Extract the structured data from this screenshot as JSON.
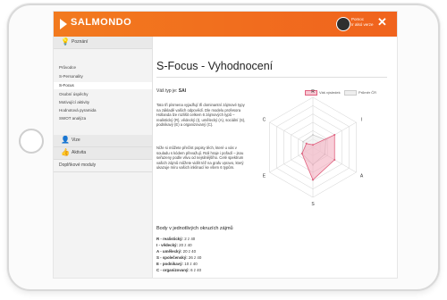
{
  "app": {
    "logo": "SALMONDO"
  },
  "user": {
    "line1": "Pomoc",
    "line2": "Ir alsó verze"
  },
  "sidebar": {
    "sections": [
      {
        "title": "Poznání",
        "icon": "lightbulb-icon"
      },
      {
        "title": "Vize",
        "icon": "person-icon"
      },
      {
        "title": "Aktivita",
        "icon": "thumbs-up-icon"
      },
      {
        "title": "Doplňkové moduly",
        "icon": ""
      }
    ],
    "items": [
      "Průvodce",
      "S-Personality",
      "S-Focus",
      "Osobní úspěchy",
      "Motivující aktivity",
      "Hodnotová pyramida",
      "SWOT analýza"
    ]
  },
  "main": {
    "title": "S-Focus - Vyhodnocení",
    "type_label": "Váš typ je:",
    "type_value": "SAI",
    "para1": "Tato tři písmena vyjadřují tři dominantní zájmové typy na základě vašich odpovědí. Dle modelu profesora Hollanda lze rozlišit celkem 6 zájmových typů – realistický (R), vědecký (I), umělecký (A), sociální (S), podnikavý (E) a organizovaný (C).",
    "para2": "Níže si můžete přečíst popisy těch, které u vás v souladu s kódem převažují. Roli hraje i pořadí – jsou seřazeny podle vlivu od nejsilnějšího. Celé spektrum vašich zájmů můžete vidět též na grafu vpravo, který ukazuje míru vašich inklinací ke všem 6 typům.",
    "scores_title": "Body v jednotlivých okruzích zájmů",
    "scores": [
      {
        "name": "R - realistický:",
        "value": "2 z 40"
      },
      {
        "name": "I - vědecký:",
        "value": "20 z 40"
      },
      {
        "name": "A - umělecký:",
        "value": "20 z 40"
      },
      {
        "name": "S - společenský:",
        "value": "26 z 40"
      },
      {
        "name": "E - podnikavý:",
        "value": "10 z 40"
      },
      {
        "name": "C - organizovaný:",
        "value": "6 z 40"
      }
    ]
  },
  "chart_data": {
    "type": "radar",
    "categories": [
      "R",
      "I",
      "A",
      "S",
      "E",
      "C"
    ],
    "max": 40,
    "rings": 6,
    "series": [
      {
        "name": "Váš výsledek",
        "values": [
          2,
          20,
          20,
          26,
          10,
          6
        ],
        "color": "#e0607e"
      },
      {
        "name": "Průměr ČR",
        "values": [
          10,
          12,
          11,
          14,
          10,
          9
        ],
        "color": "#cccccc"
      }
    ]
  }
}
